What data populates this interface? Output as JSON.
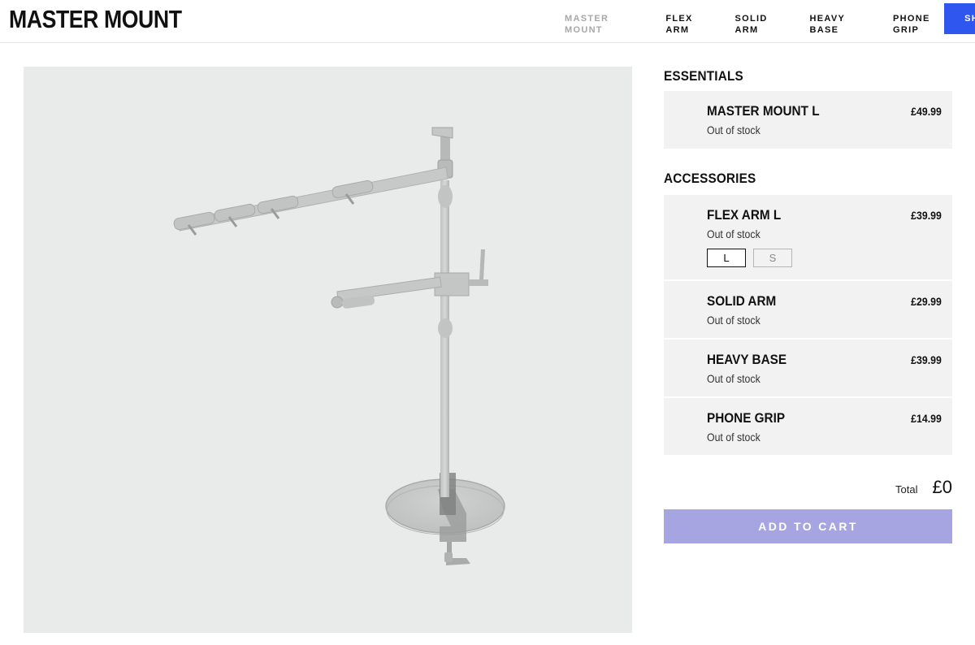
{
  "header": {
    "logo": "MASTER MOUNT",
    "nav": [
      "MASTER MOUNT",
      "FLEX ARM",
      "SOLID ARM",
      "HEAVY BASE",
      "PHONE GRIP"
    ],
    "active_nav": "MASTER MOUNT",
    "shop_button": "SHO"
  },
  "essentials": {
    "title": "ESSENTIALS",
    "items": [
      {
        "name": "MASTER MOUNT L",
        "status": "Out of stock",
        "price": "£49.99"
      }
    ]
  },
  "accessories": {
    "title": "ACCESSORIES",
    "items": [
      {
        "name": "FLEX ARM L",
        "status": "Out of stock",
        "price": "£39.99",
        "sizes": [
          "L",
          "S"
        ],
        "selected_size": "L"
      },
      {
        "name": "SOLID ARM",
        "status": "Out of stock",
        "price": "£29.99"
      },
      {
        "name": "HEAVY BASE",
        "status": "Out of stock",
        "price": "£39.99"
      },
      {
        "name": "PHONE GRIP",
        "status": "Out of stock",
        "price": "£14.99"
      }
    ]
  },
  "summary": {
    "total_label": "Total",
    "total_value": "£0",
    "add_to_cart": "ADD TO CART"
  },
  "colors": {
    "accent": "#2f57f0",
    "cart_button": "#a6a5e2",
    "visual_bg": "#e8ebea",
    "card_bg": "#f2f2f2"
  }
}
